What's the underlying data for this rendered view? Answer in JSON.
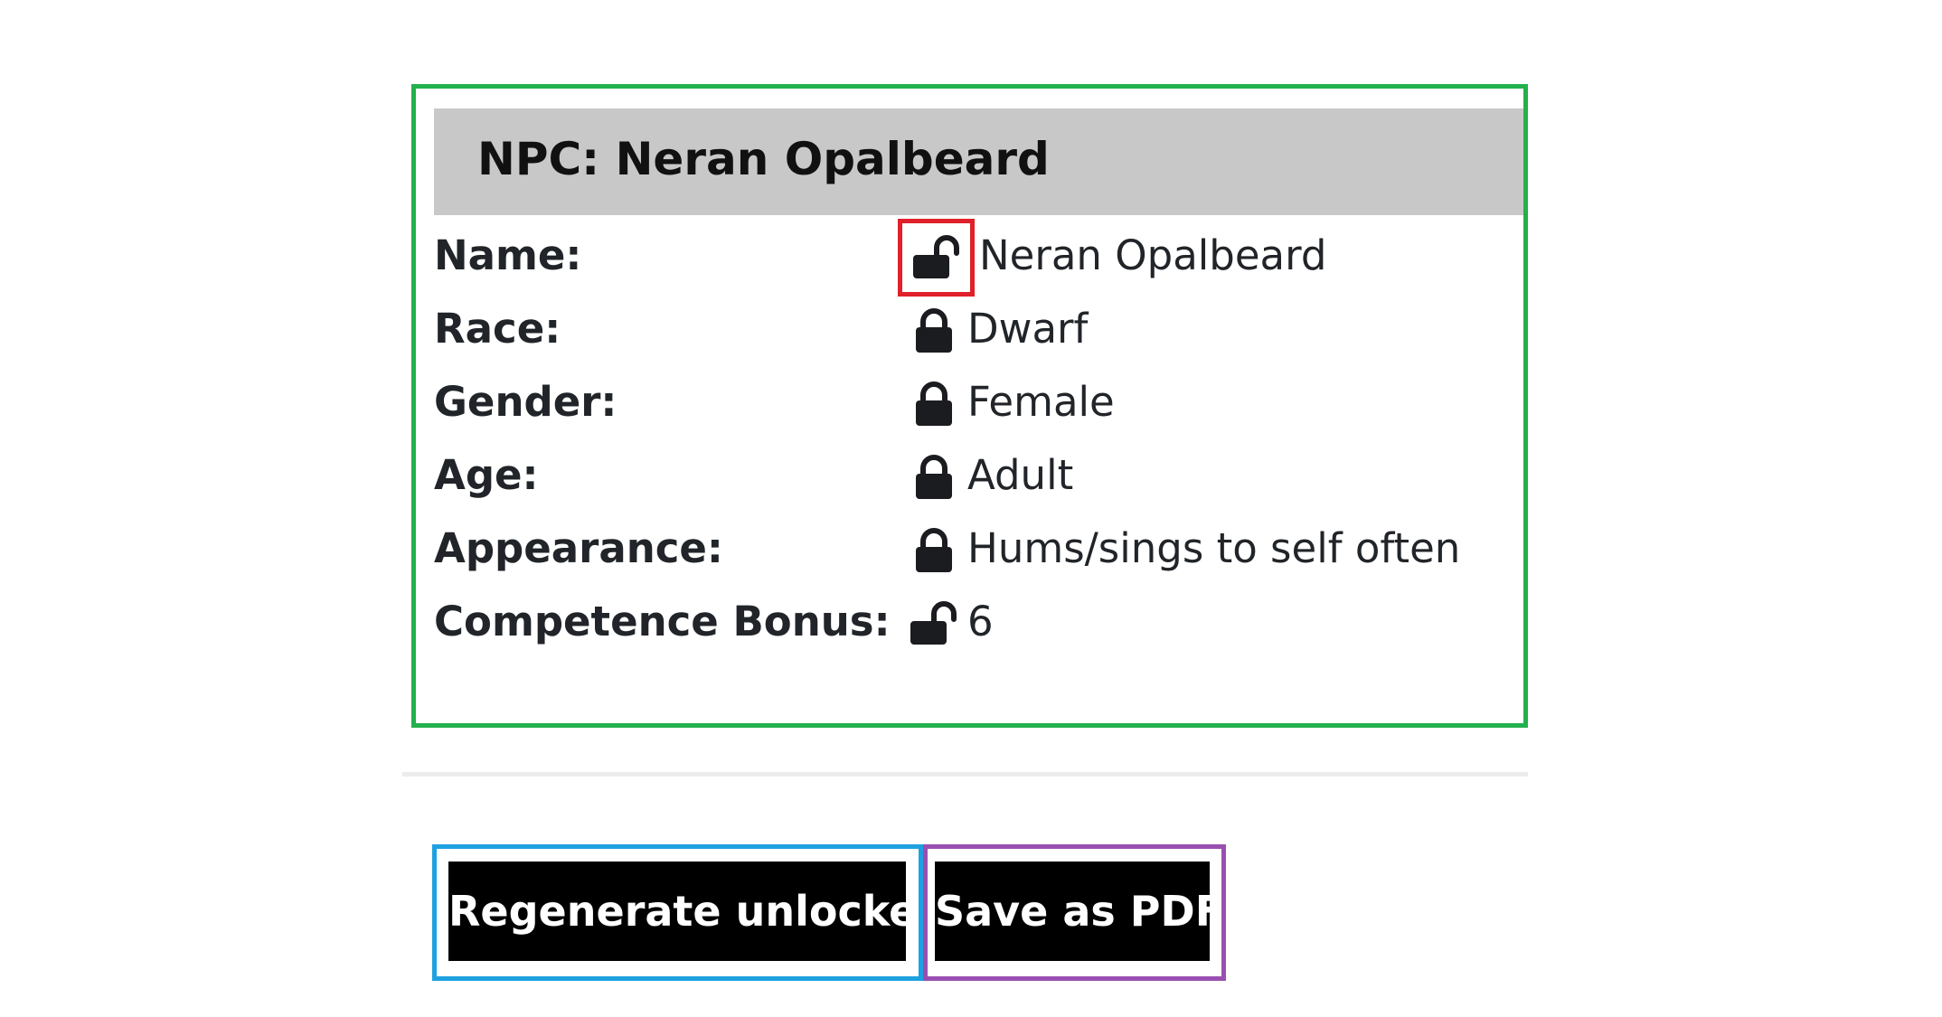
{
  "card": {
    "title": "NPC: Neran Opalbeard"
  },
  "attributes": [
    {
      "label": "Name:",
      "value": "Neran Opalbeard",
      "locked": false,
      "icon": "unlock-icon"
    },
    {
      "label": "Race:",
      "value": "Dwarf",
      "locked": true,
      "icon": "lock-icon"
    },
    {
      "label": "Gender:",
      "value": "Female",
      "locked": true,
      "icon": "lock-icon"
    },
    {
      "label": "Age:",
      "value": "Adult",
      "locked": true,
      "icon": "lock-icon"
    },
    {
      "label": "Appearance:",
      "value": "Hums/sings to self often",
      "locked": true,
      "icon": "lock-icon"
    },
    {
      "label": "Competence Bonus:",
      "value": "6",
      "locked": false,
      "icon": "unlock-icon"
    }
  ],
  "buttons": {
    "regenerate": "Regenerate unlocked",
    "save_pdf": "Save as PDF"
  },
  "colors": {
    "header_bg": "#c8c8c8",
    "button_bg": "#000000",
    "button_text": "#ffffff",
    "highlight_card": "#22b14c",
    "highlight_lock": "#e0202a",
    "highlight_regenerate": "#1ea1e0",
    "highlight_pdf": "#9a4fb0"
  }
}
